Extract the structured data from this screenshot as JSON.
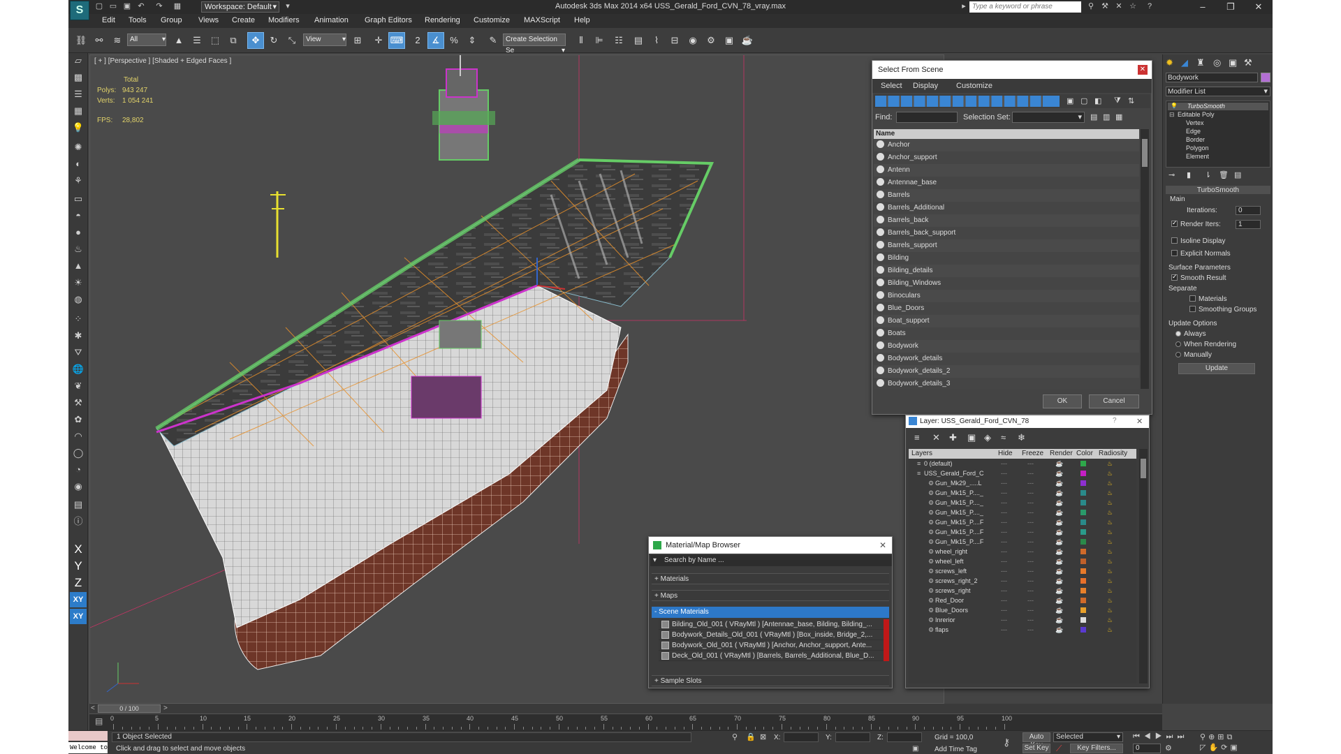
{
  "titlebar": {
    "workspace": "Workspace: Default",
    "app_title": "Autodesk 3ds Max  2014 x64    USS_Gerald_Ford_CVN_78_vray.max",
    "search_placeholder": "Type a keyword or phrase"
  },
  "menu": [
    "Edit",
    "Tools",
    "Group",
    "Views",
    "Create",
    "Modifiers",
    "Animation",
    "Graph Editors",
    "Rendering",
    "Customize",
    "MAXScript",
    "Help"
  ],
  "toolbar": {
    "selection_filter": "All",
    "ref_coord": "View",
    "named_selection": "Create Selection Se"
  },
  "viewport": {
    "label": "[ + ] [Perspective ] [Shaded + Edged Faces ]",
    "stats_total": "Total",
    "polys_label": "Polys:",
    "polys_value": "943 247",
    "verts_label": "Verts:",
    "verts_value": "1 054 241",
    "fps_label": "FPS:",
    "fps_value": "28,802"
  },
  "select_from_scene": {
    "title": "Select From Scene",
    "menu": [
      "Select",
      "Display",
      "Customize"
    ],
    "find_label": "Find:",
    "selection_set_label": "Selection Set:",
    "column_name": "Name",
    "items": [
      "Anchor",
      "Anchor_support",
      "Antenn",
      "Antennae_base",
      "Barrels",
      "Barrels_Additional",
      "Barrels_back",
      "Barrels_back_support",
      "Barrels_support",
      "Bilding",
      "Bilding_details",
      "Bilding_Windows",
      "Binoculars",
      "Blue_Doors",
      "Boat_support",
      "Boats",
      "Bodywork",
      "Bodywork_details",
      "Bodywork_details_2",
      "Bodywork_details_3"
    ],
    "ok": "OK",
    "cancel": "Cancel"
  },
  "layer_dialog": {
    "title": "Layer: USS_Gerald_Ford_CVN_78",
    "help": "?",
    "columns": [
      "Layers",
      "Hide",
      "Freeze",
      "Render",
      "Color",
      "Radiosity"
    ],
    "rows": [
      {
        "name": "0 (default)",
        "color": "#2ea84a"
      },
      {
        "name": "USS_Gerald_Ford_C",
        "color": "#c51fc4"
      },
      {
        "name": "Gun_Mk29_.....L",
        "color": "#8e2fd0"
      },
      {
        "name": "Gun_Mk15_P...._",
        "color": "#2a8a8a"
      },
      {
        "name": "Gun_Mk15_P...._",
        "color": "#2a8a8a"
      },
      {
        "name": "Gun_Mk15_P...._",
        "color": "#2a9a6a"
      },
      {
        "name": "Gun_Mk15_P....F",
        "color": "#2a8a8a"
      },
      {
        "name": "Gun_Mk15_P....F",
        "color": "#2a9a8a"
      },
      {
        "name": "Gun_Mk15_P....F",
        "color": "#2a8a4a"
      },
      {
        "name": "wheel_right",
        "color": "#d06a2a"
      },
      {
        "name": "wheel_left",
        "color": "#c0602a"
      },
      {
        "name": "screws_left",
        "color": "#e87a2a"
      },
      {
        "name": "screws_right_2",
        "color": "#e8702a"
      },
      {
        "name": "screws_right",
        "color": "#e8802a"
      },
      {
        "name": "Red_Door",
        "color": "#d06a2a"
      },
      {
        "name": "Blue_Doors",
        "color": "#e8a02a"
      },
      {
        "name": "Inrerior",
        "color": "#dddddd"
      },
      {
        "name": "flaps",
        "color": "#5a3ad0"
      }
    ]
  },
  "material_browser": {
    "title": "Material/Map Browser",
    "search_placeholder": "Search by Name ...",
    "sections": [
      "+ Materials",
      "+ Maps",
      "- Scene Materials"
    ],
    "materials": [
      "Bilding_Old_001  ( VRayMtl ) [Antennae_base, Bilding, Bilding_...",
      "Bodywork_Details_Old_001  ( VRayMtl ) [Box_inside, Bridge_2,...",
      "Bodywork_Old_001  ( VRayMtl ) [Anchor, Anchor_support, Ante...",
      "Deck_Old_001  ( VRayMtl ) [Barrels, Barrels_Additional, Blue_D..."
    ],
    "sample_slots": "+ Sample Slots"
  },
  "command_panel": {
    "object_name": "Bodywork",
    "modifier_list": "Modifier List",
    "stack": [
      "TurboSmooth",
      "Editable Poly",
      "Vertex",
      "Edge",
      "Border",
      "Polygon",
      "Element"
    ],
    "rollout_title": "TurboSmooth",
    "main_label": "Main",
    "iterations_label": "Iterations:",
    "iterations_value": "0",
    "render_iters_label": "Render Iters:",
    "render_iters_value": "1",
    "isoline": "Isoline Display",
    "explicit": "Explicit Normals",
    "surface_params": "Surface Parameters",
    "smooth_result": "Smooth Result",
    "separate": "Separate",
    "materials": "Materials",
    "smoothing_groups": "Smoothing Groups",
    "update_options": "Update Options",
    "always": "Always",
    "when_rendering": "When Rendering",
    "manually": "Manually",
    "update_btn": "Update",
    "accent_color": "#b36fd4"
  },
  "timeline": {
    "frame_display": "0 / 100",
    "ticks": [
      "0",
      "5",
      "10",
      "15",
      "20",
      "25",
      "30",
      "35",
      "40",
      "45",
      "50",
      "55",
      "60",
      "65",
      "70",
      "75",
      "80",
      "85",
      "90",
      "95",
      "100"
    ]
  },
  "status": {
    "welcome": "Welcome to M",
    "selected": "1 Object Selected",
    "prompt": "Click and drag to select and move objects",
    "x_label": "X:",
    "y_label": "Y:",
    "z_label": "Z:",
    "grid": "Grid = 100,0",
    "add_time_tag": "Add Time Tag",
    "auto_key": "Auto Key",
    "selected_dropdown": "Selected",
    "set_key": "Set Key",
    "key_filters": "Key Filters...",
    "frame": "0"
  }
}
